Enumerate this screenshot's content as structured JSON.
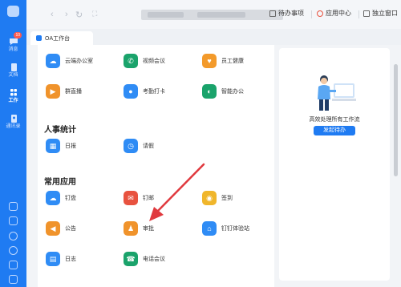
{
  "rail": {
    "badge": "10",
    "items": [
      {
        "label": "消息",
        "icon": "chat-icon"
      },
      {
        "label": "文档",
        "icon": "document-icon"
      },
      {
        "label": "工作",
        "icon": "grid-icon"
      },
      {
        "label": "通讯录",
        "icon": "contacts-icon"
      }
    ],
    "active": "工作"
  },
  "topbar": {
    "todo_label": "待办事项",
    "appcenter_label": "应用中心",
    "standalone_label": "独立窗口"
  },
  "tab": {
    "label": "OA工作台"
  },
  "top_apps": [
    {
      "label": "云端办公室",
      "color": "#2f8cf5",
      "icon": "cloud-icon"
    },
    {
      "label": "视频会议",
      "color": "#1aa36b",
      "icon": "phone-icon"
    },
    {
      "label": "员工健康",
      "color": "#f39a2b",
      "icon": "heart-icon"
    },
    {
      "label": "群直播",
      "color": "#f0932b",
      "icon": "live-icon"
    },
    {
      "label": "考勤打卡",
      "color": "#2f8cf5",
      "icon": "location-icon"
    },
    {
      "label": "智能办公",
      "color": "#1aa36b",
      "icon": "smart-icon"
    }
  ],
  "stats": {
    "title": "人事统计",
    "apps": [
      {
        "label": "日报",
        "color": "#2f8cf5",
        "icon": "calendar-icon"
      },
      {
        "label": "请假",
        "color": "#2f8cf5",
        "icon": "clock-icon"
      }
    ]
  },
  "common": {
    "title": "常用应用",
    "apps": [
      {
        "label": "钉盘",
        "color": "#2f8cf5",
        "icon": "cloud-drive-icon"
      },
      {
        "label": "钉邮",
        "color": "#e8523f",
        "icon": "mail-icon"
      },
      {
        "label": "签到",
        "color": "#f0b62b",
        "icon": "pin-icon"
      },
      {
        "label": "公告",
        "color": "#f0932b",
        "icon": "megaphone-icon"
      },
      {
        "label": "审批",
        "color": "#f0932b",
        "icon": "approval-icon"
      },
      {
        "label": "钉钉体验站",
        "color": "#2f8cf5",
        "icon": "experience-icon"
      },
      {
        "label": "日志",
        "color": "#2f8cf5",
        "icon": "log-icon"
      },
      {
        "label": "电话会议",
        "color": "#1aa36b",
        "icon": "conference-call-icon"
      }
    ]
  },
  "side": {
    "caption": "高效处理所有工作流",
    "button": "发起待办"
  }
}
